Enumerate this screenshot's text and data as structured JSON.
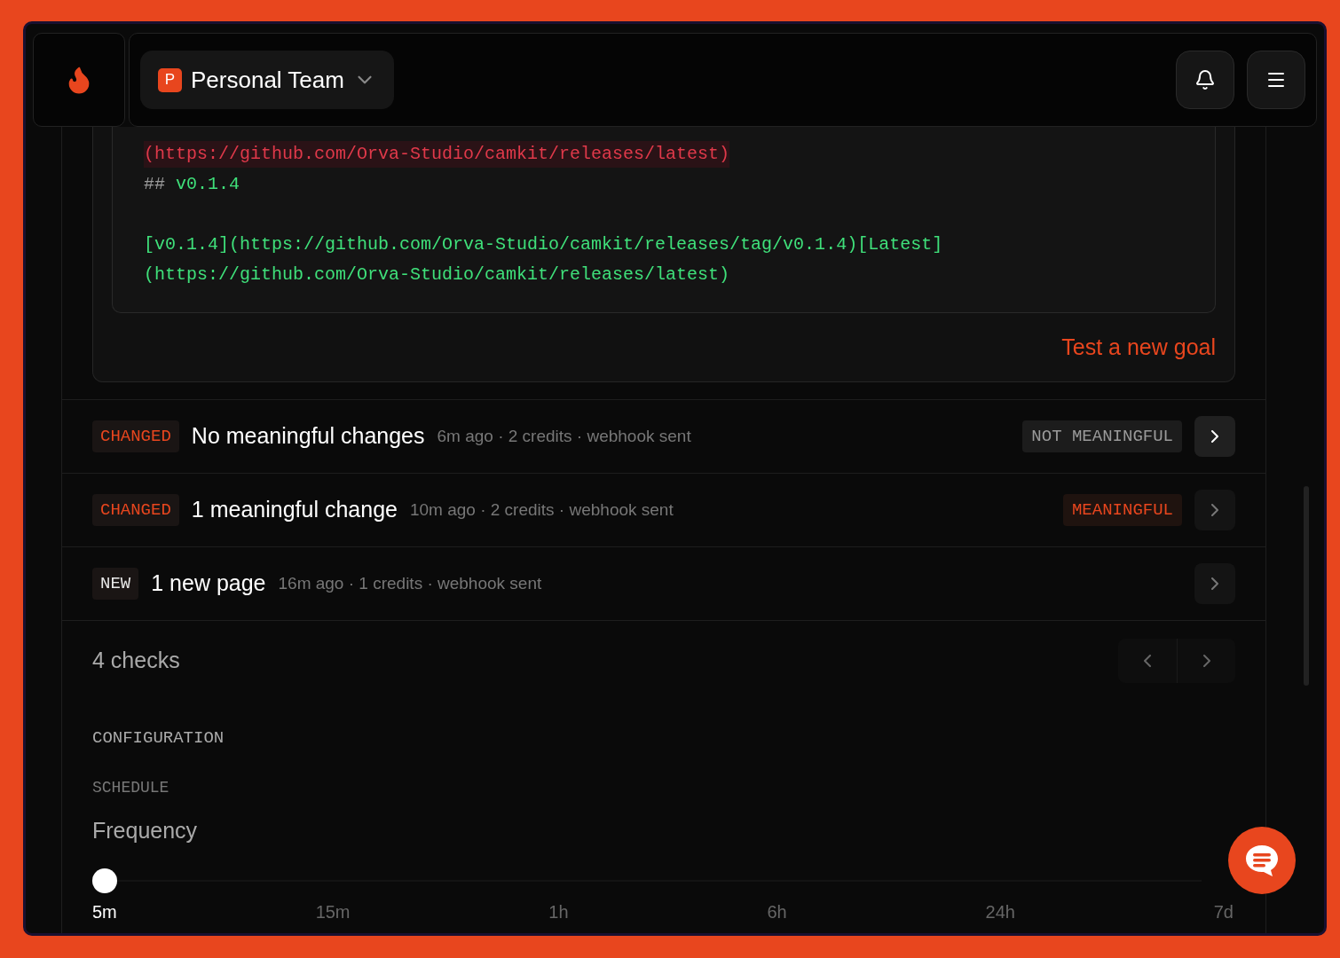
{
  "header": {
    "team_initial": "P",
    "team_name": "Personal Team"
  },
  "diff": {
    "lines": [
      {
        "kind": "removed",
        "text": "(https://github.com/Orva-Studio/camkit/releases/latest)"
      },
      {
        "kind": "heading",
        "marker": "##",
        "text": "v0.1.4"
      },
      {
        "kind": "blank"
      },
      {
        "kind": "added",
        "text": "[v0.1.4](https://github.com/Orva-Studio/camkit/releases/tag/v0.1.4)[Latest]"
      },
      {
        "kind": "added",
        "text": "(https://github.com/Orva-Studio/camkit/releases/latest)"
      }
    ],
    "action": "Test a new goal"
  },
  "checks": [
    {
      "tag": "CHANGED",
      "color": "#e8461e",
      "title": "No meaningful changes",
      "meta": "6m ago · 2 credits · webhook sent",
      "verdict": {
        "label": "NOT MEANINGFUL",
        "kind": "neutral"
      },
      "hovered": true
    },
    {
      "tag": "CHANGED",
      "color": "#e8461e",
      "title": "1 meaningful change",
      "meta": "10m ago · 2 credits · webhook sent",
      "verdict": {
        "label": "MEANINGFUL",
        "kind": "meaningful"
      },
      "hovered": false
    },
    {
      "tag": "NEW",
      "color": "#e8e8e8",
      "title": "1 new page",
      "meta": "16m ago · 1 credits · webhook sent",
      "hovered": false
    }
  ],
  "checks_count": "4 checks",
  "configuration": {
    "heading": "CONFIGURATION",
    "section": "SCHEDULE",
    "label": "Frequency",
    "level": 0,
    "options": [
      {
        "label": "5m",
        "selected": true
      },
      {
        "label": "15m",
        "selected": false
      },
      {
        "label": "1h",
        "selected": false
      },
      {
        "label": "6h",
        "selected": false
      },
      {
        "label": "24h",
        "selected": false
      },
      {
        "label": "7d",
        "selected": false
      }
    ]
  }
}
